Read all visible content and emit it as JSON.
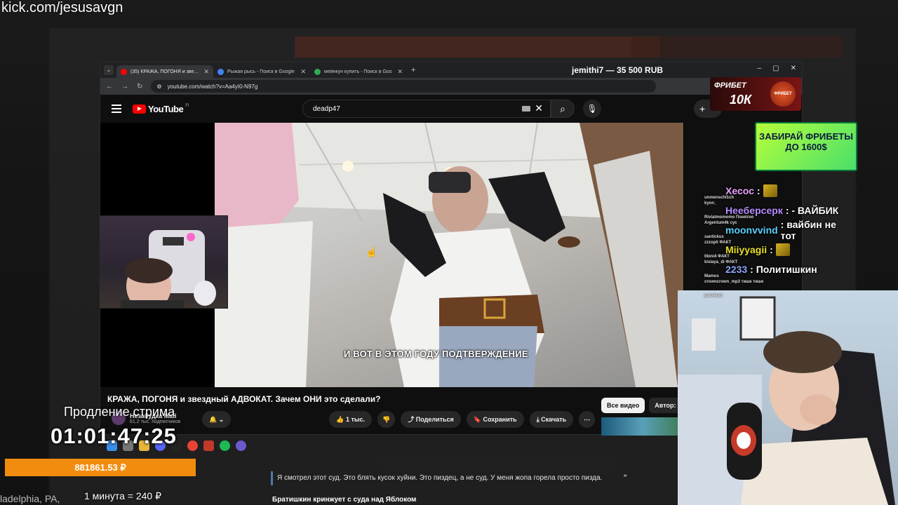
{
  "overlay": {
    "kick_url": "kick.com/jesusavgn",
    "prolong_label": "Продление стрима",
    "timer": "01:01:47:25",
    "money": "881861.53 ₽",
    "rate": "1 минута = 240 ₽",
    "city": "ladelphia, PA,",
    "quote": "Я смотрел этот суд. Это блять кусок хуйни. Это пиздец, а не суд. У меня жопа горела просто пизда.",
    "quote_mark": "❞",
    "caption": "Братишкин кринжует с суда над Яблоком"
  },
  "browser": {
    "title": "jemithi7 — 35 500 RUB",
    "tabs": [
      {
        "title": "(35) КРАЖА, ПОГОНЯ и звездн",
        "favicon_color": "#ff0000",
        "active": true
      },
      {
        "title": "Рыжая рысь - Поиск в Google",
        "favicon_color": "#4285f4",
        "active": false
      },
      {
        "title": "мейнкун купить - Поиск в Goo",
        "favicon_color": "#34a853",
        "active": false
      }
    ],
    "tab_close": "✕",
    "new_tab": "+",
    "url": "youtube.com/watch?v=Aa4yI0-N97g",
    "win_controls": [
      "–",
      "▢",
      "✕"
    ]
  },
  "youtube": {
    "logo_word": "YouTube",
    "logo_region": "FI",
    "search_value": "deadp47",
    "search_clear": "✕",
    "create_label": "+",
    "subtitle": "И ВОТ В ЭТОМ ГОДУ ПОДТВЕРЖДЕНИЕ",
    "video_title": "КРАЖА, ПОГОНЯ и звездный АДВОКАТ. Зачем ОНИ это сделали?",
    "channel_name": "Незабудка Mail",
    "channel_subs": "61,2 тыс. подписчиков",
    "actions": {
      "bell": "🔔 ⌄",
      "like": "👍 1 тыс.",
      "dislike": "👎",
      "share": "⤴ Поделиться",
      "save": "🔖 Сохранить",
      "download": "⤓ Скачать",
      "more": "⋯"
    },
    "chips": [
      "Все видео",
      "Автор: Не"
    ]
  },
  "chat": [
    {
      "nick": "Хесос",
      "msg": ":",
      "color": "#e8a0ff",
      "emote": true,
      "tiny_top": "",
      "tiny_bottom": "unmenschl1ch"
    },
    {
      "nick": "Неeберсерк",
      "msg": ": - ВАЙБИК",
      "color": "#b58cff",
      "emote": false,
      "tiny_top": "kyon_",
      "tiny_bottom": "Rivlatmomomo Понятно"
    },
    {
      "nick": "moonvvind",
      "msg": ": вайбин не тот",
      "color": "#5ad2ff",
      "emote": false,
      "tiny_top": "Argentum4k сус",
      "tiny_bottom": "santickus"
    },
    {
      "nick": "Miiyyagii",
      "msg": ":",
      "color": "#e6e02a",
      "emote": true,
      "tiny_top": "zzzopli ФАКТ",
      "tiny_bottom": "0bini4 ФАКТ"
    },
    {
      "nick": "2233",
      "msg": ": Политишкин",
      "color": "#8fa8ff",
      "emote": false,
      "tiny_top": "kislaya_di ФАКТ",
      "tiny_bottom": "Mamos"
    },
    {
      "nick": "",
      "msg": "",
      "color": "#ffffff",
      "emote": false,
      "tiny_top": "crowncrown_mp3 тише тише",
      "tiny_bottom": "palo4kaii"
    }
  ],
  "ads": {
    "top_line1": "ФРИБЕТ",
    "top_line2": "10К",
    "top_logo": "ФРИБЕТ",
    "green": "ЗАБИРАЙ ФРИБЕТЫ ДО 1600$"
  }
}
